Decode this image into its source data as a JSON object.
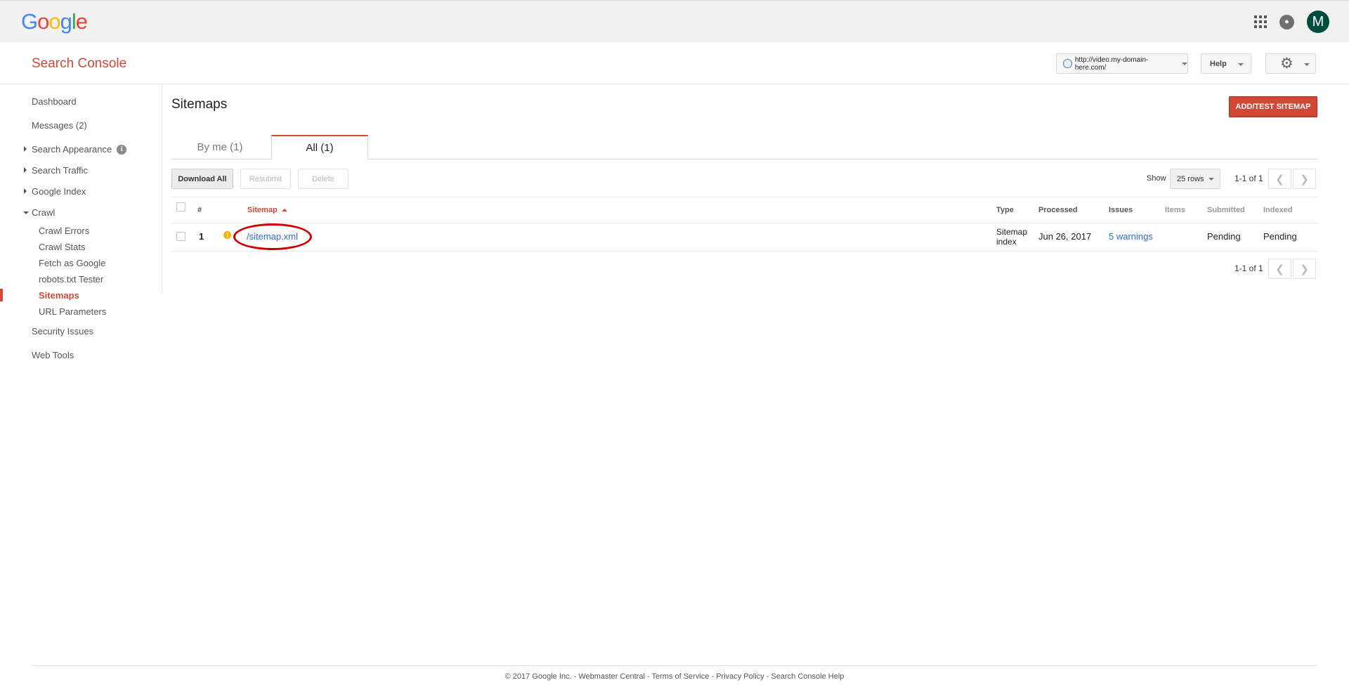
{
  "google_bar": {
    "logo_letters": [
      {
        "ch": "G",
        "color": "#4285f4"
      },
      {
        "ch": "o",
        "color": "#ea4335"
      },
      {
        "ch": "o",
        "color": "#fbbc05"
      },
      {
        "ch": "g",
        "color": "#4285f4"
      },
      {
        "ch": "l",
        "color": "#34a853"
      },
      {
        "ch": "e",
        "color": "#ea4335"
      }
    ],
    "avatar_letter": "M",
    "icons": [
      "apps-grid-icon",
      "bell-icon"
    ]
  },
  "header": {
    "app_title": "Search Console",
    "site_url": "http://video.my-domain-here.com/",
    "help_label": "Help"
  },
  "sidebar": {
    "dashboard": "Dashboard",
    "messages": "Messages (2)",
    "search_appearance": "Search Appearance",
    "search_traffic": "Search Traffic",
    "google_index": "Google Index",
    "crawl": "Crawl",
    "crawl_items": [
      "Crawl Errors",
      "Crawl Stats",
      "Fetch as Google",
      "robots.txt Tester",
      "Sitemaps",
      "URL Parameters"
    ],
    "active_item": "Sitemaps",
    "security_issues": "Security Issues",
    "web_tools": "Web Tools"
  },
  "main": {
    "page_title": "Sitemaps",
    "add_button": "ADD/TEST SITEMAP",
    "tabs": [
      {
        "label": "By me (1)",
        "active": false
      },
      {
        "label": "All (1)",
        "active": true
      }
    ],
    "toolbar": {
      "download_all": "Download All",
      "resubmit": "Resubmit",
      "delete": "Delete",
      "show_label": "Show",
      "rows_value": "25 rows",
      "pager_text": "1-1 of 1"
    },
    "table": {
      "columns": [
        "#",
        "Sitemap",
        "Type",
        "Processed",
        "Issues",
        "Items",
        "Submitted",
        "Indexed"
      ],
      "rows": [
        {
          "num": "1",
          "sitemap": "/sitemap.xml",
          "type_line1": "Sitemap",
          "type_line2": "index",
          "processed": "Jun 26, 2017",
          "issues": "5 warnings",
          "items": "",
          "submitted": "Pending",
          "indexed": "Pending"
        }
      ]
    },
    "bottom_pager_text": "1-1 of 1"
  },
  "footer": {
    "copyright": "© 2017 Google Inc.",
    "sep": " - ",
    "links": [
      "Webmaster Central",
      "Terms of Service",
      "Privacy Policy",
      "Search Console Help"
    ]
  },
  "colors": {
    "accent_red": "#d14836",
    "link_blue": "#3367d6",
    "avatar_bg": "#004d40",
    "warning_yellow": "#f4b400"
  }
}
